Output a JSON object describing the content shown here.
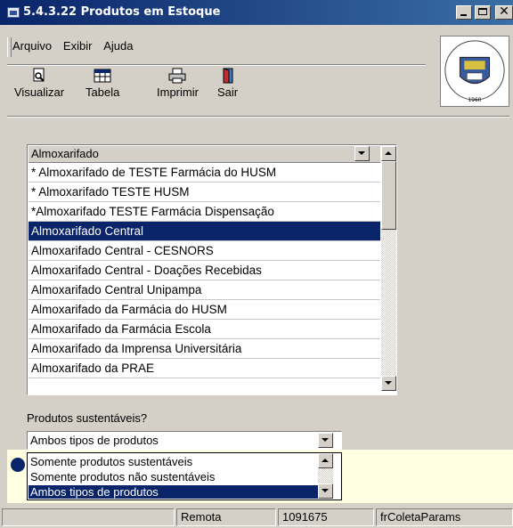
{
  "window": {
    "title": "5.4.3.22 Produtos em Estoque"
  },
  "menu": {
    "items": [
      "Arquivo",
      "Exibir",
      "Ajuda"
    ]
  },
  "toolbar": {
    "buttons": [
      {
        "label": "Visualizar",
        "icon": "preview-icon"
      },
      {
        "label": "Tabela",
        "icon": "table-icon"
      },
      {
        "label": "Imprimir",
        "icon": "printer-icon"
      },
      {
        "label": "Sair",
        "icon": "exit-icon"
      }
    ]
  },
  "logo": {
    "icon": "university-seal-logo",
    "text": "Universidade Federal de Santa Maria 1960"
  },
  "list": {
    "header": "Almoxarifado",
    "rows": [
      "* Almoxarifado de TESTE Farmácia do HUSM",
      "* Almoxarifado TESTE HUSM",
      "*Almoxarifado TESTE Farmácia Dispensação",
      "Almoxarifado Central",
      "Almoxarifado Central - CESNORS",
      "Almoxarifado Central - Doações Recebidas",
      "Almoxarifado Central Unipampa",
      "Almoxarifado da Farmácia do HUSM",
      "Almoxarifado da Farmácia Escola",
      "Almoxarifado da Imprensa Universitária",
      "Almoxarifado da PRAE"
    ],
    "selected": "Almoxarifado Central"
  },
  "sustentaveis": {
    "label": "Produtos sustentáveis?",
    "value": "Ambos tipos de produtos",
    "options": [
      "Somente produtos sustentáveis",
      "Somente produtos não sustentáveis",
      "Ambos tipos de produtos"
    ]
  },
  "statusbar": {
    "panels": [
      "",
      "Remota",
      "1091675",
      "frColetaParams"
    ]
  },
  "colors": {
    "titlebar": "#0a246a",
    "selection": "#0a246a",
    "face": "#d4d0c8",
    "info": "#ffffe1"
  }
}
